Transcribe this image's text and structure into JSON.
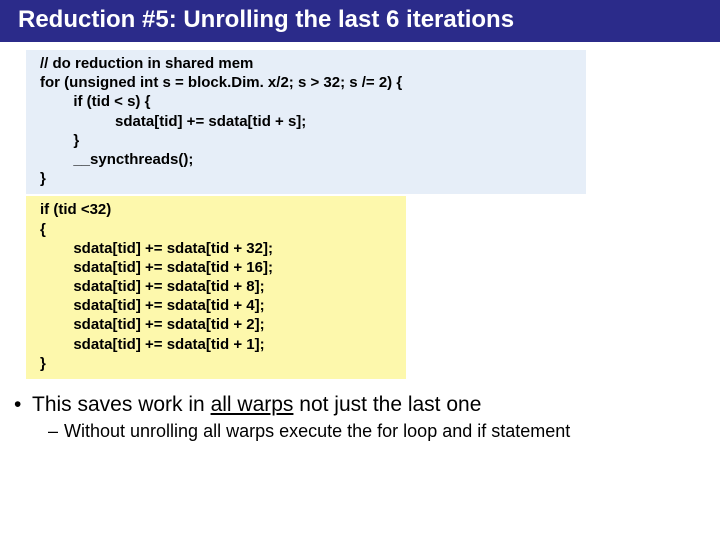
{
  "title": "Reduction #5: Unrolling the last 6 iterations",
  "code1": {
    "l1": "// do reduction in shared mem",
    "l2": "for (unsigned int s = block.Dim. x/2; s > 32; s /= 2) {",
    "l3": "",
    "l4": "        if (tid < s) {",
    "l5": "                  sdata[tid] += sdata[tid + s];",
    "l6": "        }",
    "l7": "        __syncthreads();",
    "l8": "}"
  },
  "code2": {
    "l1": "if (tid <32)",
    "l2": "{",
    "l3": "        sdata[tid] += sdata[tid + 32];",
    "l4": "        sdata[tid] += sdata[tid + 16];",
    "l5": "        sdata[tid] += sdata[tid + 8];",
    "l6": "        sdata[tid] += sdata[tid + 4];",
    "l7": "        sdata[tid] += sdata[tid + 2];",
    "l8": "        sdata[tid] += sdata[tid + 1];",
    "l9": "}"
  },
  "bullet1": {
    "pre": "This saves work in ",
    "underlined": "all warps",
    "post": " not just the last one"
  },
  "bullet2": "Without unrolling all warps execute the for loop and if statement"
}
